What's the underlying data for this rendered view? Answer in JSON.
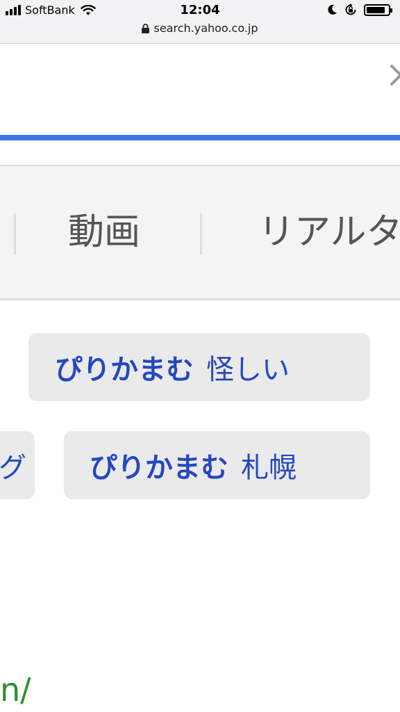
{
  "status_bar": {
    "carrier": "SoftBank",
    "time": "12:04",
    "url": "search.yahoo.co.jp",
    "battery_level": 0.85,
    "icons": [
      "signal-icon",
      "wifi-icon",
      "moon-icon",
      "rotation-lock-icon",
      "battery-icon",
      "lock-icon"
    ]
  },
  "search": {
    "value": "",
    "accent_color": "#3d78e6"
  },
  "tabs": [
    {
      "label": "動画"
    },
    {
      "label": "リアルタ"
    }
  ],
  "suggestions": [
    {
      "main": "ぴりかまむ",
      "sub": "怪しい"
    },
    {
      "partial": "グ"
    },
    {
      "main": "ぴりかまむ",
      "sub": "札幌"
    }
  ],
  "result_url_fragment": "n/"
}
